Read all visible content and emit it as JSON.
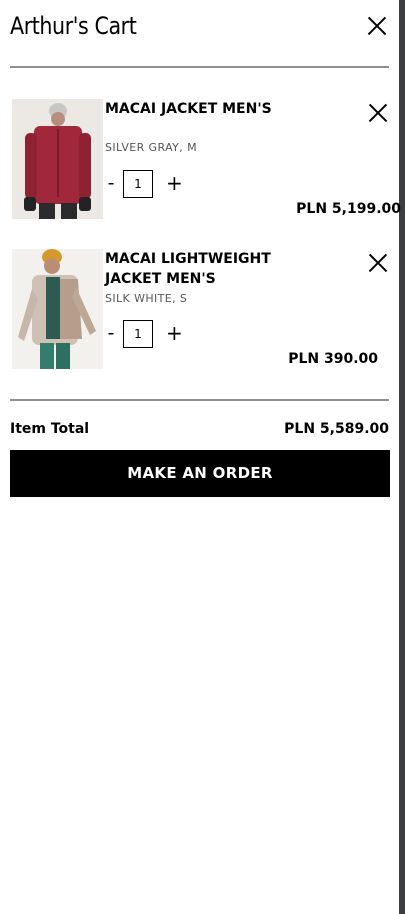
{
  "cart": {
    "title": "Arthur's Cart",
    "items": [
      {
        "name": "MACAI JACKET MEN'S",
        "variant": "SILVER GRAY, M",
        "qty_minus": "-",
        "qty": "1",
        "qty_plus": "+",
        "price": "PLN 5,199.00"
      },
      {
        "name": "MACAI LIGHTWEIGHT JACKET MEN'S",
        "variant": "SILK WHITE, S",
        "qty_minus": "-",
        "qty": "1",
        "qty_plus": "+",
        "price": "PLN 390.00"
      }
    ],
    "total_label": "Item Total",
    "total_value": "PLN 5,589.00",
    "order_button": "MAKE AN ORDER"
  },
  "colors": {
    "accent": "#000000",
    "divider": "#8f8f8f",
    "side_bar": "#3b3d41"
  }
}
